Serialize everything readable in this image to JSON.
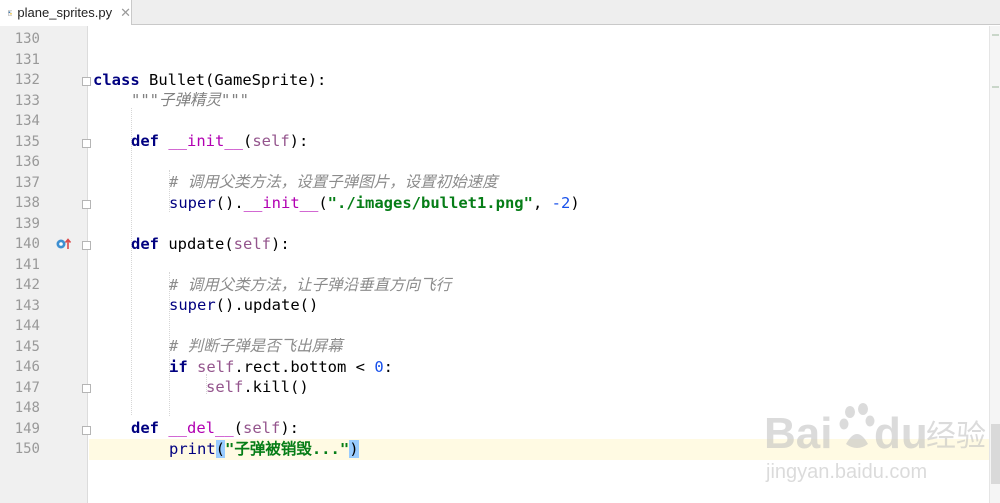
{
  "tab": {
    "filename": "plane_sprites.py",
    "close_glyph": "✕",
    "icon": "python-file-icon"
  },
  "gutter": {
    "line_numbers": [
      "130",
      "131",
      "132",
      "133",
      "134",
      "135",
      "136",
      "137",
      "138",
      "139",
      "140",
      "141",
      "142",
      "143",
      "144",
      "145",
      "146",
      "147",
      "148",
      "149",
      "150"
    ],
    "markers": {
      "override_marker_line": "140",
      "intention_bulb_line": "150"
    }
  },
  "code": {
    "l132": {
      "kw": "class",
      "name": " Bullet(GameSprite):"
    },
    "l133": {
      "doc": "\"\"\"子弹精灵\"\"\""
    },
    "l135": {
      "kw": "def",
      "magic": "__init__",
      "open": "(",
      "self": "self",
      "close": "):"
    },
    "l137": {
      "comment": "# 调用父类方法，设置子弹图片，设置初始速度"
    },
    "l138": {
      "super": "super",
      "mid": "().",
      "magic": "__init__",
      "open": "(",
      "str": "\"./images/bullet1.png\"",
      "sep": ", ",
      "num": "-2",
      "close": ")"
    },
    "l140": {
      "kw": "def",
      "name": " update(",
      "self": "self",
      "close": "):"
    },
    "l142": {
      "comment": "# 调用父类方法，让子弹沿垂直方向飞行"
    },
    "l143": {
      "super": "super",
      "rest": "().update()"
    },
    "l145": {
      "comment": "# 判断子弹是否飞出屏幕"
    },
    "l146": {
      "kw": "if",
      "self": "self",
      "mid": ".rect.bottom < ",
      "num": "0",
      "close": ":"
    },
    "l147": {
      "self": "self",
      "rest": ".kill()"
    },
    "l149": {
      "kw": "def",
      "magic": "__del__",
      "open": "(",
      "self": "self",
      "close": "):"
    },
    "l150": {
      "print": "print",
      "open": "(",
      "str": "\"子弹被销毁...\"",
      "close": ")"
    }
  },
  "watermark": {
    "brand": "Bai",
    "brand2": "du",
    "product": "经验",
    "url": "jingyan.baidu.com"
  }
}
